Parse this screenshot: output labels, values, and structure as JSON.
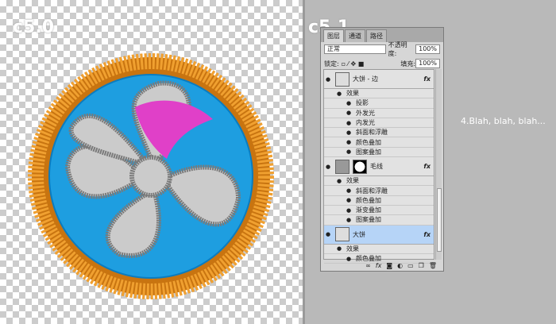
{
  "labels": {
    "left": "c5.0",
    "right": "c5.1"
  },
  "note": "4.Blah, blah, blah...",
  "panel": {
    "tabs": [
      "图层",
      "通道",
      "路径"
    ],
    "blend_mode": "正常",
    "opacity_label": "不透明度:",
    "opacity": "100%",
    "lock_label": "锁定:",
    "fill_label": "填充:",
    "fill": "100%",
    "layers": [
      {
        "name": "大饼 - 边",
        "fx": "fx",
        "effects_label": "效果",
        "effects": [
          "投影",
          "外发光",
          "内发光",
          "斜面和浮雕",
          "颜色叠加",
          "图案叠加"
        ],
        "selected": false
      },
      {
        "name": "毛线",
        "fx": "fx",
        "effects_label": "效果",
        "effects": [
          "斜面和浮雕",
          "颜色叠加",
          "渐变叠加",
          "图案叠加"
        ],
        "selected": false
      },
      {
        "name": "大饼",
        "fx": "fx",
        "effects_label": "效果",
        "effects": [
          "颜色叠加"
        ],
        "selected": true
      }
    ],
    "toolbar": [
      "link-icon",
      "fx-icon",
      "mask-icon",
      "adjustment-icon",
      "group-icon",
      "new-layer-icon",
      "trash-icon"
    ]
  },
  "colors": {
    "ring": "#e8961e",
    "inner": "#1ea0e0",
    "fan": "#c8c8c8",
    "highlight": "#e040c8",
    "selected_layer": "#b6d4f7"
  }
}
